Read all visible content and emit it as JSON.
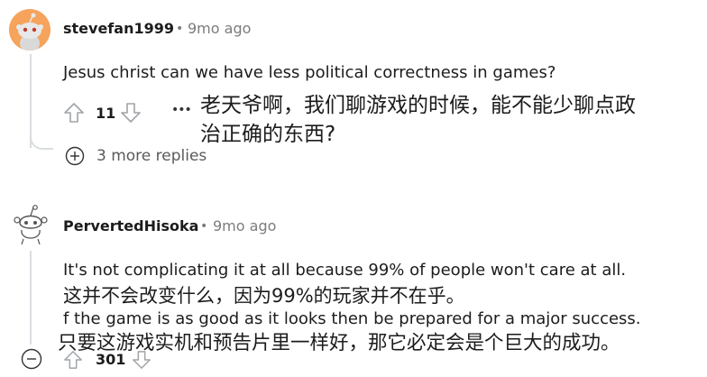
{
  "comments": [
    {
      "username": "stevefan1999",
      "separator": "•",
      "time": "9mo ago",
      "body": "Jesus christ can we have less political correctness in games?",
      "translation_lines": [
        "老天爷啊，我们聊游戏的时候，能不能少聊点政",
        "治正确的东西?"
      ],
      "votes": "11",
      "more_label": "•••",
      "replies_label": "3 more replies"
    },
    {
      "username": "PervertedHisoka",
      "separator": "•",
      "time": "9mo ago",
      "body_line1": "It's not complicating it at all because 99% of people won't care at all.",
      "translation_line1": "这并不会改变什么，因为99%的玩家并不在乎。",
      "body_line2": "f the game is as good as it looks then be prepared for a major success.",
      "translation_line2": "只要这游戏实机和预告片里一样好，那它必定会是个巨大的成功。",
      "votes": "301"
    }
  ],
  "colors": {
    "avatar_bg": "#f6a35c",
    "vote_icon": "#a0a4a8",
    "thread_line": "#d9dde0"
  }
}
